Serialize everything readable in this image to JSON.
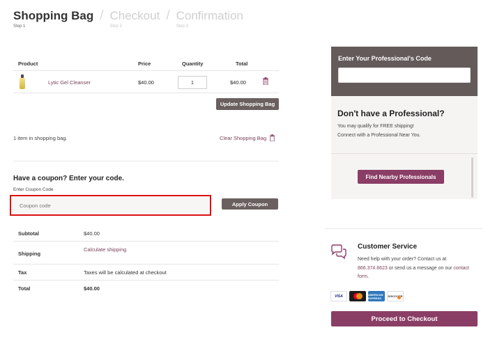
{
  "steps": [
    {
      "title": "Shopping Bag",
      "sub": "Step 1"
    },
    {
      "title": "Checkout",
      "sub": "Step 2"
    },
    {
      "title": "Confirmation",
      "sub": "Step 3"
    }
  ],
  "step_separator": "/",
  "cart": {
    "headers": {
      "product": "Product",
      "price": "Price",
      "quantity": "Quantity",
      "total": "Total"
    },
    "items": [
      {
        "name": "Lytic Gel Cleanser",
        "price": "$40.00",
        "quantity": "1",
        "total": "$40.00",
        "thumb_icon": "product-bottle-icon",
        "delete_icon": "trash-icon"
      }
    ],
    "update_label": "Update Shopping Bag",
    "count_text": "1 item in shopping bag.",
    "clear_label": "Clear Shopping Bag"
  },
  "coupon": {
    "title": "Have a coupon? Enter your code.",
    "label": "Enter Coupon Code",
    "placeholder": "Coupon code",
    "apply_label": "Apply Coupon"
  },
  "totals": {
    "subtotal_label": "Subtotal",
    "subtotal_value": "$40.00",
    "shipping_label": "Shipping",
    "shipping_value": "Calculate shipping",
    "tax_label": "Tax",
    "tax_value": "Taxes will be calculated at checkout",
    "total_label": "Total",
    "total_value": "$40.00"
  },
  "professional": {
    "code_title": "Enter Your Professional's Code",
    "code_value": "",
    "question": "Don't have a Professional?",
    "desc1": "You may qualify for FREE shipping!",
    "desc2": "Connect with a Professional Near You.",
    "find_label": "Find Nearby Professionals"
  },
  "customer_service": {
    "title": "Customer Service",
    "text_before_phone": "Need help with your order? Contact us at",
    "phone": "866.374.6623",
    "text_middle": " or send us a message on our",
    "link": "contact form",
    "text_end": ".",
    "icon": "chat-bubbles-icon"
  },
  "payment_cards": {
    "visa": "VISA",
    "mastercard": "mastercard-icon",
    "amex": "AMERICAN EXPRESS",
    "discover": "DISCOVER"
  },
  "checkout_label": "Proceed to Checkout",
  "colors": {
    "accent": "#8a3e66",
    "dark_button": "#6b6060",
    "panel_dark": "#645a5a",
    "panel_light": "#f6f4f3",
    "link": "#7a3f57",
    "highlight_border": "#dd1111"
  }
}
